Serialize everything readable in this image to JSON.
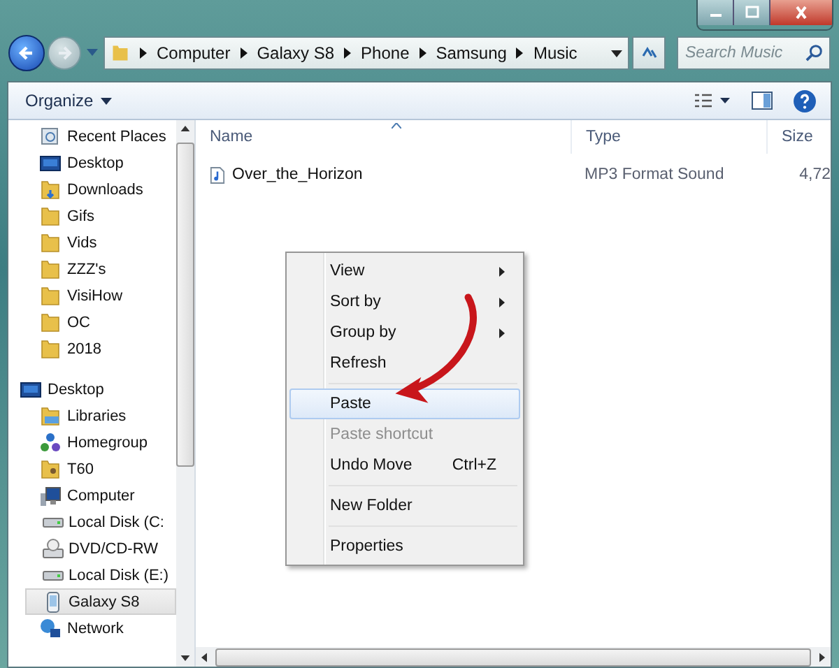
{
  "window": {
    "controls": [
      {
        "kind": "minimize"
      },
      {
        "kind": "maximize"
      },
      {
        "kind": "close"
      }
    ]
  },
  "address_bar": {
    "crumbs": [
      "Computer",
      "Galaxy S8",
      "Phone",
      "Samsung",
      "Music"
    ]
  },
  "search": {
    "placeholder": "Search Music"
  },
  "toolbar": {
    "organize": "Organize"
  },
  "sidebar": {
    "favorites": [
      {
        "label": "Recent Places",
        "kind": "recent",
        "selected": false
      },
      {
        "label": "Desktop",
        "kind": "desktop",
        "selected": false
      },
      {
        "label": "Downloads",
        "kind": "downloads",
        "selected": false
      },
      {
        "label": "Gifs",
        "kind": "folder",
        "selected": false
      },
      {
        "label": "Vids",
        "kind": "folder",
        "selected": false
      },
      {
        "label": "ZZZ's",
        "kind": "folder",
        "selected": false
      },
      {
        "label": "VisiHow",
        "kind": "folder",
        "selected": false
      },
      {
        "label": "OC",
        "kind": "folder",
        "selected": false
      },
      {
        "label": "2018",
        "kind": "folder",
        "selected": false
      }
    ],
    "tree": [
      {
        "label": "Desktop",
        "kind": "desktop",
        "selected": false,
        "children": [
          {
            "label": "Libraries",
            "kind": "libraries",
            "selected": false
          },
          {
            "label": "Homegroup",
            "kind": "homegroup",
            "selected": false
          },
          {
            "label": "T60",
            "kind": "user",
            "selected": false
          },
          {
            "label": "Computer",
            "kind": "computer",
            "selected": false,
            "children": [
              {
                "label": "Local Disk (C:",
                "kind": "disk",
                "selected": false
              },
              {
                "label": "DVD/CD-RW",
                "kind": "dvd",
                "selected": false
              },
              {
                "label": "Local Disk (E:)",
                "kind": "disk",
                "selected": false
              },
              {
                "label": "Galaxy S8",
                "kind": "phone",
                "selected": true
              }
            ]
          },
          {
            "label": "Network",
            "kind": "network",
            "selected": false
          }
        ]
      }
    ]
  },
  "table": {
    "columns": [
      "Name",
      "Type",
      "Size"
    ],
    "rows": [
      {
        "name": "Over_the_Horizon",
        "type": "MP3 Format Sound",
        "size": "4,72"
      }
    ]
  },
  "context_menu": {
    "items": [
      {
        "kind": "item",
        "label": "View",
        "submenu": true,
        "disabled": false,
        "selected": false
      },
      {
        "kind": "item",
        "label": "Sort by",
        "submenu": true,
        "disabled": false,
        "selected": false
      },
      {
        "kind": "item",
        "label": "Group by",
        "submenu": true,
        "disabled": false,
        "selected": false
      },
      {
        "kind": "item",
        "label": "Refresh",
        "submenu": false,
        "disabled": false,
        "selected": false
      },
      {
        "kind": "separator"
      },
      {
        "kind": "item",
        "label": "Paste",
        "submenu": false,
        "disabled": false,
        "selected": true
      },
      {
        "kind": "item",
        "label": "Paste shortcut",
        "submenu": false,
        "disabled": true,
        "selected": false
      },
      {
        "kind": "item",
        "label": "Undo Move",
        "shortcut": "Ctrl+Z",
        "submenu": false,
        "disabled": false,
        "selected": false
      },
      {
        "kind": "separator"
      },
      {
        "kind": "item",
        "label": "New Folder",
        "submenu": false,
        "disabled": false,
        "selected": false
      },
      {
        "kind": "separator"
      },
      {
        "kind": "item",
        "label": "Properties",
        "submenu": false,
        "disabled": false,
        "selected": false
      }
    ]
  }
}
